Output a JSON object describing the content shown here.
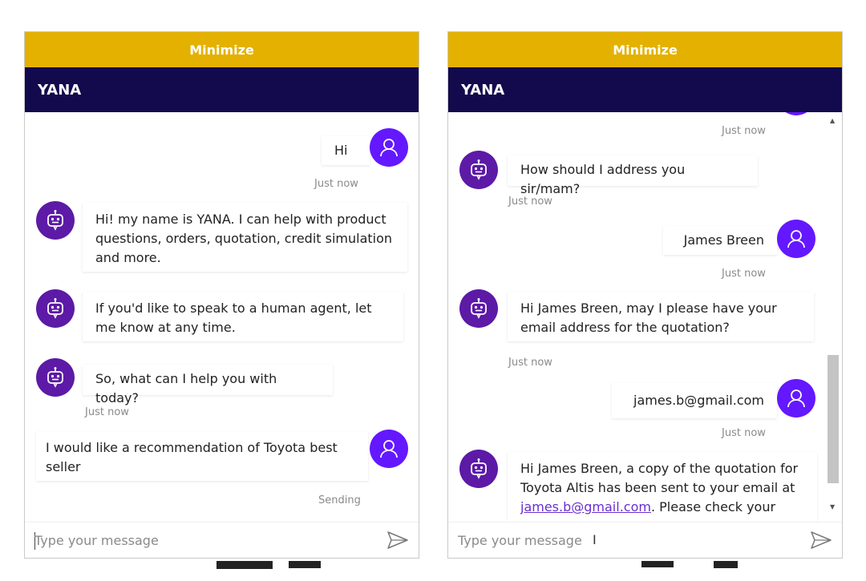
{
  "left": {
    "minimize": "Minimize",
    "title": "YANA",
    "messages": {
      "m1": "Hi",
      "t1": "Just now",
      "m2": "Hi! my name is YANA. I can help with product questions, orders, quotation, credit simulation and more.",
      "m3": "If you'd like to speak to a human agent, let me know at any time.",
      "m4": "So, what can I help you with today?",
      "t4": "Just now",
      "m5": "I would like a recommendation of Toyota best seller",
      "t5": "Sending"
    },
    "input_placeholder": "Type your message"
  },
  "right": {
    "minimize": "Minimize",
    "title": "YANA",
    "messages": {
      "t0": "Just now",
      "m1": "How should I address you sir/mam?",
      "t1": "Just now",
      "m2": "James Breen",
      "t2": "Just now",
      "m3": "Hi James Breen, may I please have your email address for the quotation?",
      "t3": "Just now",
      "m4": "james.b@gmail.com",
      "t4": "Just now",
      "m5_pre": "Hi James Breen, a copy of the quotation for Toyota Altis has been sent to your email at",
      "m5_link": "james.b@gmail.com",
      "m5_post": ".  Please check your"
    },
    "input_placeholder": "Type your message"
  },
  "colors": {
    "minimize_bar": "#e4b100",
    "title_bar": "#120a4c",
    "user_avatar": "#6418ff",
    "bot_avatar": "#5c1aa6"
  },
  "icons": {
    "user": "user-icon",
    "bot": "bot-icon",
    "send": "send-icon",
    "scroll_up": "scroll-up-arrow-icon",
    "scroll_down": "scroll-down-arrow-icon"
  }
}
